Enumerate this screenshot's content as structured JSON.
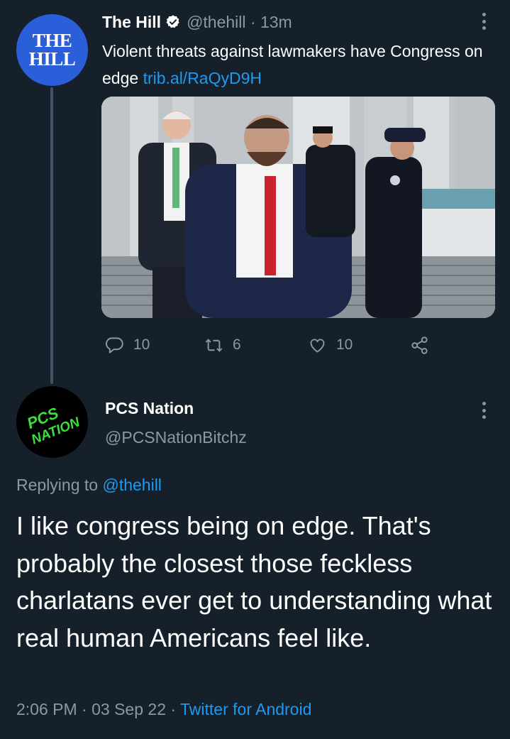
{
  "original_tweet": {
    "avatar_text_line1": "THE",
    "avatar_text_line2": "HILL",
    "display_name": "The Hill",
    "handle": "@thehill",
    "separator": " · ",
    "time_ago": "13m",
    "text": "Violent threats against lawmakers have Congress on edge ",
    "link_text": "trib.al/RaQyD9H",
    "actions": {
      "reply_count": "10",
      "retweet_count": "6",
      "like_count": "10"
    },
    "icons": [
      "verified-badge-icon",
      "more-options-icon",
      "reply-icon",
      "retweet-icon",
      "like-icon",
      "share-icon"
    ]
  },
  "reply_tweet": {
    "avatar_text_line1": "PCS",
    "avatar_text_line2": "NATION",
    "display_name": "PCS Nation",
    "handle": "@PCSNationBitchz",
    "replying_prefix": "Replying to ",
    "replying_to": "@thehill",
    "text": "I like congress being on edge. That's probably the closest those feckless charlatans ever get to understanding what real human Americans feel like.",
    "time": "2:06 PM",
    "date": "03 Sep 22",
    "separator": " · ",
    "source": "Twitter for Android"
  },
  "colors": {
    "background": "#15202b",
    "text": "#ffffff",
    "muted": "#8b98a5",
    "link": "#1d9bf0",
    "thread_line": "#3d5466",
    "hill_avatar": "#2b5fd9",
    "pcs_green": "#39e03a"
  }
}
